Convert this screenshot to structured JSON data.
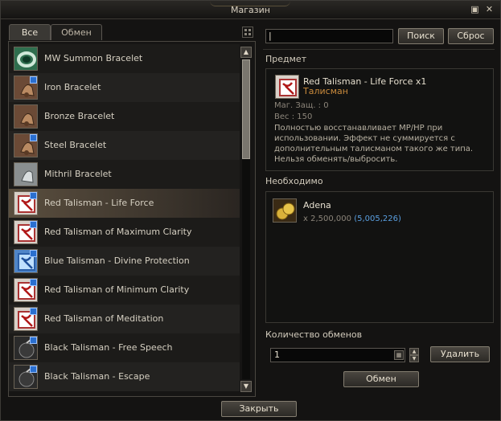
{
  "window": {
    "title": "Магазин"
  },
  "tabs": [
    {
      "label": "Все",
      "active": true
    },
    {
      "label": "Обмен",
      "active": false
    }
  ],
  "items": [
    {
      "label": "MW Summon Bracelet",
      "icon": "green-bracelet-icon",
      "badge": false,
      "color": "#2f6e4e"
    },
    {
      "label": "Iron Bracelet",
      "icon": "bronze-bell-bracelet-icon",
      "badge": true,
      "color": "#6b4a36"
    },
    {
      "label": "Bronze Bracelet",
      "icon": "bronze-bell-bracelet-icon",
      "badge": false,
      "color": "#6b4a36"
    },
    {
      "label": "Steel Bracelet",
      "icon": "bronze-bell-bracelet-icon",
      "badge": true,
      "color": "#6b4a36"
    },
    {
      "label": "Mithril Bracelet",
      "icon": "mithril-bracelet-icon",
      "badge": false,
      "color": "#8a8f90"
    },
    {
      "label": "Red Talisman - Life Force",
      "icon": "red-talisman-icon",
      "badge": true,
      "color": "#d8d0c8"
    },
    {
      "label": "Red Talisman of Maximum Clarity",
      "icon": "red-talisman-icon",
      "badge": true,
      "color": "#d8d0c8"
    },
    {
      "label": "Blue Talisman - Divine Protection",
      "icon": "blue-talisman-icon",
      "badge": true,
      "color": "#4f85c8"
    },
    {
      "label": "Red Talisman of Minimum Clarity",
      "icon": "red-talisman-icon",
      "badge": true,
      "color": "#d8d0c8"
    },
    {
      "label": "Red Talisman of Meditation",
      "icon": "red-talisman-icon",
      "badge": true,
      "color": "#d8d0c8"
    },
    {
      "label": "Black Talisman - Free Speech",
      "icon": "black-talisman-icon",
      "badge": true,
      "color": "#2b2b2b"
    },
    {
      "label": "Black Talisman - Escape",
      "icon": "black-talisman-icon",
      "badge": true,
      "color": "#2b2b2b"
    }
  ],
  "search": {
    "value": "",
    "search_label": "Поиск",
    "reset_label": "Сброс"
  },
  "item_section": {
    "heading": "Предмет",
    "name": "Red Talisman - Life Force x1",
    "type": "Талисман",
    "mdef": "Маг. Защ. : 0",
    "weight": "Вес : 150",
    "description": "Полностью восстанавливает MP/HP при использовании. Эффект не суммируется с дополнительным талисманом такого же типа. Нельзя обменять/выбросить."
  },
  "required": {
    "heading": "Необходимо",
    "name": "Adena",
    "amount": "x 2,500,000",
    "owned": "(5,005,226)"
  },
  "exchange": {
    "heading": "Количество обменов",
    "quantity": "1",
    "delete_label": "Удалить",
    "exchange_label": "Обмен"
  },
  "close_label": "Закрыть",
  "colors": {
    "accent": "#5a9fe0",
    "type": "#c98a3c",
    "muted": "#8c857a"
  }
}
